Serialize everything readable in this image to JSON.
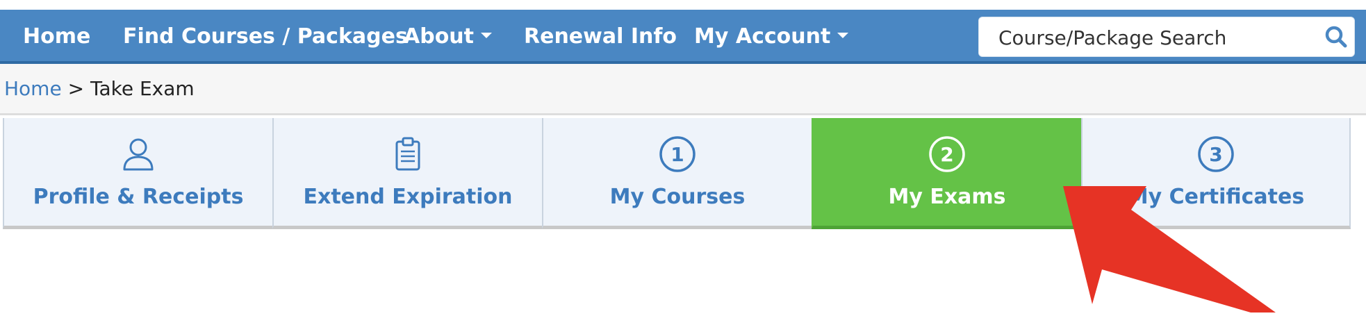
{
  "nav": {
    "items": [
      {
        "label": "Home"
      },
      {
        "label": "Find Courses / Packages"
      },
      {
        "label": "About"
      },
      {
        "label": "Renewal Info"
      },
      {
        "label": "My Account"
      }
    ],
    "search": {
      "placeholder": "Course/Package Search",
      "icon": "search-icon"
    }
  },
  "breadcrumb": {
    "home": "Home",
    "separator": ">",
    "current": "Take Exam"
  },
  "tabs": [
    {
      "label": "Profile & Receipts",
      "icon": "user-icon"
    },
    {
      "label": "Extend Expiration",
      "icon": "clipboard-icon"
    },
    {
      "label": "My Courses",
      "icon": "step-1-icon",
      "step": "1"
    },
    {
      "label": "My Exams",
      "icon": "step-2-icon",
      "step": "2",
      "active": true
    },
    {
      "label": "My Certificates",
      "icon": "step-3-icon",
      "step": "3"
    }
  ],
  "colors": {
    "navbar": "#4a87c3",
    "link": "#3d7bbd",
    "tab_bg": "#eef3fa",
    "active_tab": "#64c247",
    "annotation_arrow": "#e63325"
  }
}
